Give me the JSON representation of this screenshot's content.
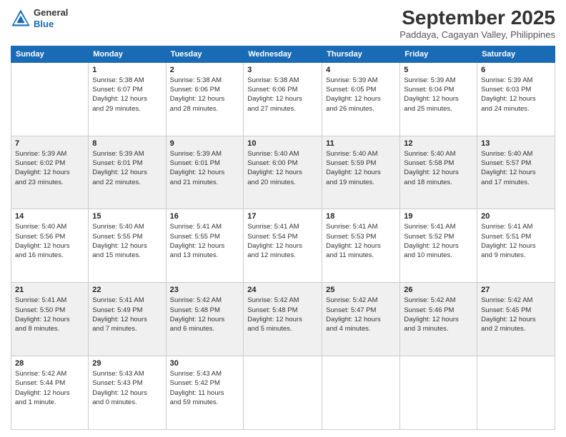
{
  "logo": {
    "general": "General",
    "blue": "Blue"
  },
  "header": {
    "month": "September 2025",
    "location": "Paddaya, Cagayan Valley, Philippines"
  },
  "weekdays": [
    "Sunday",
    "Monday",
    "Tuesday",
    "Wednesday",
    "Thursday",
    "Friday",
    "Saturday"
  ],
  "weeks": [
    [
      {
        "day": "",
        "info": ""
      },
      {
        "day": "1",
        "info": "Sunrise: 5:38 AM\nSunset: 6:07 PM\nDaylight: 12 hours\nand 29 minutes."
      },
      {
        "day": "2",
        "info": "Sunrise: 5:38 AM\nSunset: 6:06 PM\nDaylight: 12 hours\nand 28 minutes."
      },
      {
        "day": "3",
        "info": "Sunrise: 5:38 AM\nSunset: 6:06 PM\nDaylight: 12 hours\nand 27 minutes."
      },
      {
        "day": "4",
        "info": "Sunrise: 5:39 AM\nSunset: 6:05 PM\nDaylight: 12 hours\nand 26 minutes."
      },
      {
        "day": "5",
        "info": "Sunrise: 5:39 AM\nSunset: 6:04 PM\nDaylight: 12 hours\nand 25 minutes."
      },
      {
        "day": "6",
        "info": "Sunrise: 5:39 AM\nSunset: 6:03 PM\nDaylight: 12 hours\nand 24 minutes."
      }
    ],
    [
      {
        "day": "7",
        "info": "Sunrise: 5:39 AM\nSunset: 6:02 PM\nDaylight: 12 hours\nand 23 minutes."
      },
      {
        "day": "8",
        "info": "Sunrise: 5:39 AM\nSunset: 6:01 PM\nDaylight: 12 hours\nand 22 minutes."
      },
      {
        "day": "9",
        "info": "Sunrise: 5:39 AM\nSunset: 6:01 PM\nDaylight: 12 hours\nand 21 minutes."
      },
      {
        "day": "10",
        "info": "Sunrise: 5:40 AM\nSunset: 6:00 PM\nDaylight: 12 hours\nand 20 minutes."
      },
      {
        "day": "11",
        "info": "Sunrise: 5:40 AM\nSunset: 5:59 PM\nDaylight: 12 hours\nand 19 minutes."
      },
      {
        "day": "12",
        "info": "Sunrise: 5:40 AM\nSunset: 5:58 PM\nDaylight: 12 hours\nand 18 minutes."
      },
      {
        "day": "13",
        "info": "Sunrise: 5:40 AM\nSunset: 5:57 PM\nDaylight: 12 hours\nand 17 minutes."
      }
    ],
    [
      {
        "day": "14",
        "info": "Sunrise: 5:40 AM\nSunset: 5:56 PM\nDaylight: 12 hours\nand 16 minutes."
      },
      {
        "day": "15",
        "info": "Sunrise: 5:40 AM\nSunset: 5:55 PM\nDaylight: 12 hours\nand 15 minutes."
      },
      {
        "day": "16",
        "info": "Sunrise: 5:41 AM\nSunset: 5:55 PM\nDaylight: 12 hours\nand 13 minutes."
      },
      {
        "day": "17",
        "info": "Sunrise: 5:41 AM\nSunset: 5:54 PM\nDaylight: 12 hours\nand 12 minutes."
      },
      {
        "day": "18",
        "info": "Sunrise: 5:41 AM\nSunset: 5:53 PM\nDaylight: 12 hours\nand 11 minutes."
      },
      {
        "day": "19",
        "info": "Sunrise: 5:41 AM\nSunset: 5:52 PM\nDaylight: 12 hours\nand 10 minutes."
      },
      {
        "day": "20",
        "info": "Sunrise: 5:41 AM\nSunset: 5:51 PM\nDaylight: 12 hours\nand 9 minutes."
      }
    ],
    [
      {
        "day": "21",
        "info": "Sunrise: 5:41 AM\nSunset: 5:50 PM\nDaylight: 12 hours\nand 8 minutes."
      },
      {
        "day": "22",
        "info": "Sunrise: 5:41 AM\nSunset: 5:49 PM\nDaylight: 12 hours\nand 7 minutes."
      },
      {
        "day": "23",
        "info": "Sunrise: 5:42 AM\nSunset: 5:48 PM\nDaylight: 12 hours\nand 6 minutes."
      },
      {
        "day": "24",
        "info": "Sunrise: 5:42 AM\nSunset: 5:48 PM\nDaylight: 12 hours\nand 5 minutes."
      },
      {
        "day": "25",
        "info": "Sunrise: 5:42 AM\nSunset: 5:47 PM\nDaylight: 12 hours\nand 4 minutes."
      },
      {
        "day": "26",
        "info": "Sunrise: 5:42 AM\nSunset: 5:46 PM\nDaylight: 12 hours\nand 3 minutes."
      },
      {
        "day": "27",
        "info": "Sunrise: 5:42 AM\nSunset: 5:45 PM\nDaylight: 12 hours\nand 2 minutes."
      }
    ],
    [
      {
        "day": "28",
        "info": "Sunrise: 5:42 AM\nSunset: 5:44 PM\nDaylight: 12 hours\nand 1 minute."
      },
      {
        "day": "29",
        "info": "Sunrise: 5:43 AM\nSunset: 5:43 PM\nDaylight: 12 hours\nand 0 minutes."
      },
      {
        "day": "30",
        "info": "Sunrise: 5:43 AM\nSunset: 5:42 PM\nDaylight: 11 hours\nand 59 minutes."
      },
      {
        "day": "",
        "info": ""
      },
      {
        "day": "",
        "info": ""
      },
      {
        "day": "",
        "info": ""
      },
      {
        "day": "",
        "info": ""
      }
    ]
  ]
}
